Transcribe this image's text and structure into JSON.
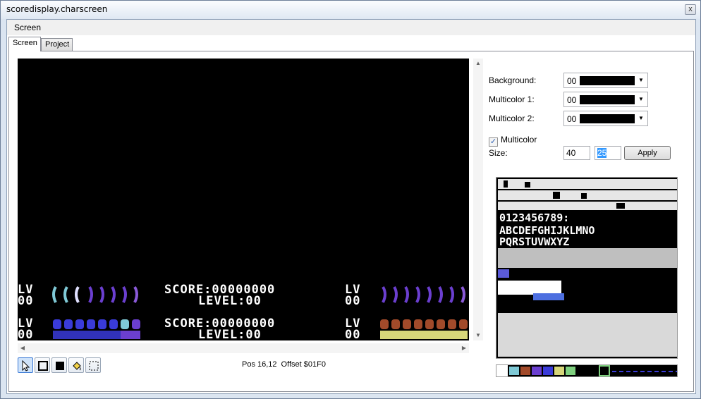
{
  "window": {
    "title": "scoredisplay.charscreen",
    "close_label": "x"
  },
  "menu": {
    "screen_label": "Screen"
  },
  "tabs": [
    {
      "label": "Screen"
    },
    {
      "label": "Project"
    }
  ],
  "props": {
    "background_label": "Background:",
    "background_value": "00",
    "multicolor1_label": "Multicolor 1:",
    "multicolor1_value": "00",
    "multicolor2_label": "Multicolor 2:",
    "multicolor2_value": "00",
    "multicolor_label": "Multicolor",
    "multicolor_checked": true,
    "size_label": "Size:",
    "width_value": "40",
    "height_value": "25",
    "apply_label": "Apply"
  },
  "status": {
    "pos": "Pos 16,12",
    "offset": "Offset $01F0"
  },
  "screen_text": {
    "lv": "LV",
    "oo": "00",
    "score": "SCORE:00000000",
    "level": "LEVEL:00"
  },
  "colors": {
    "accent": "#3399ff",
    "screen_bg": "#000000",
    "cyan": "#7fc9d6",
    "purple": "#6b3fd0",
    "blue": "#3a3bd9",
    "brown": "#a24a2a",
    "yellow": "#d6d67a"
  },
  "toolbar": {
    "tools": [
      {
        "icon": "pointer-icon"
      },
      {
        "icon": "rectangle-outline-icon"
      },
      {
        "icon": "rectangle-filled-icon"
      },
      {
        "icon": "fill-bucket-icon"
      },
      {
        "icon": "selection-marquee-icon"
      }
    ]
  }
}
